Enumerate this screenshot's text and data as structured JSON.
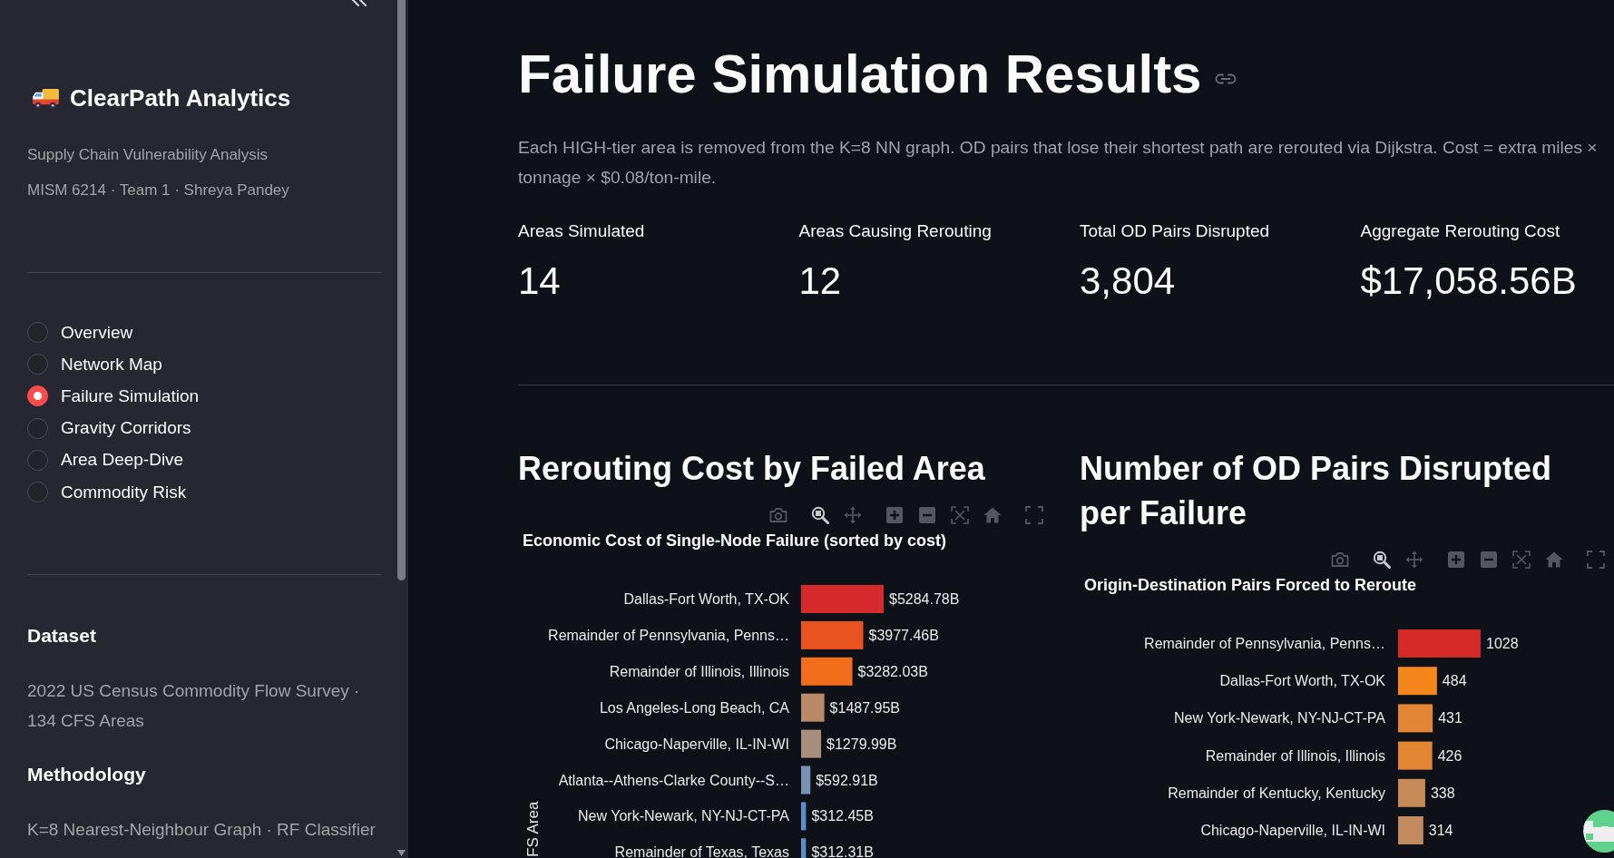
{
  "sidebar": {
    "brand": "ClearPath Analytics",
    "captions": [
      "Supply Chain Vulnerability Analysis",
      "MISM 6214 · Team 1 · Shreya Pandey"
    ],
    "nav": [
      {
        "label": "Overview",
        "selected": false
      },
      {
        "label": "Network Map",
        "selected": false
      },
      {
        "label": "Failure Simulation",
        "selected": true
      },
      {
        "label": "Gravity Corridors",
        "selected": false
      },
      {
        "label": "Area Deep-Dive",
        "selected": false
      },
      {
        "label": "Commodity Risk",
        "selected": false
      }
    ],
    "sections": [
      {
        "heading": "Dataset",
        "text": "2022 US Census Commodity Flow Survey · 134 CFS Areas"
      },
      {
        "heading": "Methodology",
        "text": "K=8 Nearest-Neighbour Graph · RF Classifier"
      }
    ]
  },
  "page": {
    "title": "Failure Simulation Results",
    "description": "Each HIGH-tier area is removed from the K=8 NN graph. OD pairs that lose their shortest path are rerouted via Dijkstra. Cost = extra miles × tonnage × $0.08/ton-mile.",
    "metrics": [
      {
        "label": "Areas Simulated",
        "value": "14"
      },
      {
        "label": "Areas Causing Rerouting",
        "value": "12"
      },
      {
        "label": "Total OD Pairs Disrupted",
        "value": "3,804"
      },
      {
        "label": "Aggregate Rerouting Cost",
        "value": "$17,058.56B"
      }
    ]
  },
  "panels": [
    {
      "heading": "Rerouting Cost by Failed Area",
      "modebar": [
        {
          "kind": "camera",
          "selected": false
        },
        {
          "kind": "zoom",
          "selected": true
        },
        {
          "kind": "pan",
          "selected": false
        },
        {
          "kind": "zoom_in",
          "selected": false
        },
        {
          "kind": "zoom_out",
          "selected": false
        },
        {
          "kind": "autoscale",
          "selected": false
        },
        {
          "kind": "home",
          "selected": false
        },
        {
          "kind": "fullscreen",
          "selected": false
        }
      ],
      "chart_data": {
        "type": "bar",
        "orientation": "horizontal",
        "title": "Economic Cost of Single-Node Failure (sorted by cost)",
        "ylabel": "FS Area",
        "categories": [
          "Dallas-Fort Worth, TX-OK",
          "Remainder of Pennsylvania, Penns…",
          "Remainder of Illinois, Illinois",
          "Los Angeles-Long Beach, CA",
          "Chicago-Naperville, IL-IN-WI",
          "Atlanta--Athens-Clarke County--S…",
          "New York-Newark, NY-NJ-CT-PA",
          "Remainder of Texas, Texas"
        ],
        "values": [
          5284.78,
          3977.46,
          3282.03,
          1487.95,
          1279.99,
          592.91,
          312.45,
          312.31
        ],
        "colors": [
          "#d42a2c",
          "#e9531f",
          "#f36e1a",
          "#b98a69",
          "#a88e7c",
          "#7892b5",
          "#5a8fcf",
          "#5a8fcf"
        ],
        "value_labels": [
          "$5284.78B",
          "$3977.46B",
          "$3282.03B",
          "$1487.95B",
          "$1279.99B",
          "$592.91B",
          "$312.45B",
          "$312.31B"
        ]
      }
    },
    {
      "heading": "Number of OD Pairs Disrupted per Failure",
      "modebar": [
        {
          "kind": "camera",
          "selected": false
        },
        {
          "kind": "zoom",
          "selected": true
        },
        {
          "kind": "pan",
          "selected": false
        },
        {
          "kind": "zoom_in",
          "selected": false
        },
        {
          "kind": "zoom_out",
          "selected": false
        },
        {
          "kind": "autoscale",
          "selected": false
        },
        {
          "kind": "home",
          "selected": false
        },
        {
          "kind": "fullscreen",
          "selected": false
        }
      ],
      "chart_data": {
        "type": "bar",
        "orientation": "horizontal",
        "title": "Origin-Destination Pairs Forced to Reroute",
        "categories": [
          "Remainder of Pennsylvania, Penns…",
          "Dallas-Fort Worth, TX-OK",
          "New York-Newark, NY-NJ-CT-PA",
          "Remainder of Illinois, Illinois",
          "Remainder of Kentucky, Kentucky",
          "Chicago-Naperville, IL-IN-WI"
        ],
        "values": [
          1028,
          484,
          431,
          426,
          338,
          314
        ],
        "colors": [
          "#d62a28",
          "#f5861c",
          "#e38633",
          "#e28634",
          "#c58a57",
          "#c18b5e"
        ],
        "value_labels": [
          "1028",
          "484",
          "431",
          "426",
          "338",
          "314"
        ]
      }
    }
  ]
}
